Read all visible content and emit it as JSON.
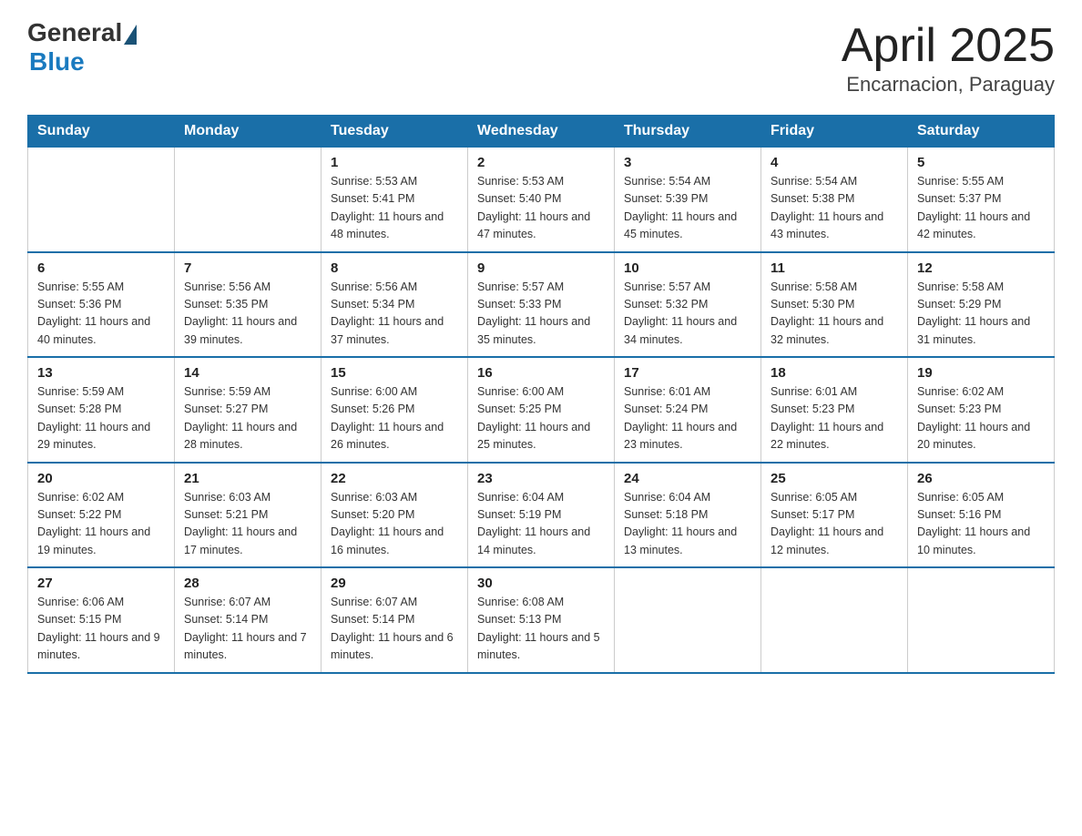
{
  "header": {
    "logo_general": "General",
    "logo_blue": "Blue",
    "month_title": "April 2025",
    "location": "Encarnacion, Paraguay"
  },
  "weekdays": [
    "Sunday",
    "Monday",
    "Tuesday",
    "Wednesday",
    "Thursday",
    "Friday",
    "Saturday"
  ],
  "weeks": [
    [
      {
        "day": "",
        "sunrise": "",
        "sunset": "",
        "daylight": ""
      },
      {
        "day": "",
        "sunrise": "",
        "sunset": "",
        "daylight": ""
      },
      {
        "day": "1",
        "sunrise": "Sunrise: 5:53 AM",
        "sunset": "Sunset: 5:41 PM",
        "daylight": "Daylight: 11 hours and 48 minutes."
      },
      {
        "day": "2",
        "sunrise": "Sunrise: 5:53 AM",
        "sunset": "Sunset: 5:40 PM",
        "daylight": "Daylight: 11 hours and 47 minutes."
      },
      {
        "day": "3",
        "sunrise": "Sunrise: 5:54 AM",
        "sunset": "Sunset: 5:39 PM",
        "daylight": "Daylight: 11 hours and 45 minutes."
      },
      {
        "day": "4",
        "sunrise": "Sunrise: 5:54 AM",
        "sunset": "Sunset: 5:38 PM",
        "daylight": "Daylight: 11 hours and 43 minutes."
      },
      {
        "day": "5",
        "sunrise": "Sunrise: 5:55 AM",
        "sunset": "Sunset: 5:37 PM",
        "daylight": "Daylight: 11 hours and 42 minutes."
      }
    ],
    [
      {
        "day": "6",
        "sunrise": "Sunrise: 5:55 AM",
        "sunset": "Sunset: 5:36 PM",
        "daylight": "Daylight: 11 hours and 40 minutes."
      },
      {
        "day": "7",
        "sunrise": "Sunrise: 5:56 AM",
        "sunset": "Sunset: 5:35 PM",
        "daylight": "Daylight: 11 hours and 39 minutes."
      },
      {
        "day": "8",
        "sunrise": "Sunrise: 5:56 AM",
        "sunset": "Sunset: 5:34 PM",
        "daylight": "Daylight: 11 hours and 37 minutes."
      },
      {
        "day": "9",
        "sunrise": "Sunrise: 5:57 AM",
        "sunset": "Sunset: 5:33 PM",
        "daylight": "Daylight: 11 hours and 35 minutes."
      },
      {
        "day": "10",
        "sunrise": "Sunrise: 5:57 AM",
        "sunset": "Sunset: 5:32 PM",
        "daylight": "Daylight: 11 hours and 34 minutes."
      },
      {
        "day": "11",
        "sunrise": "Sunrise: 5:58 AM",
        "sunset": "Sunset: 5:30 PM",
        "daylight": "Daylight: 11 hours and 32 minutes."
      },
      {
        "day": "12",
        "sunrise": "Sunrise: 5:58 AM",
        "sunset": "Sunset: 5:29 PM",
        "daylight": "Daylight: 11 hours and 31 minutes."
      }
    ],
    [
      {
        "day": "13",
        "sunrise": "Sunrise: 5:59 AM",
        "sunset": "Sunset: 5:28 PM",
        "daylight": "Daylight: 11 hours and 29 minutes."
      },
      {
        "day": "14",
        "sunrise": "Sunrise: 5:59 AM",
        "sunset": "Sunset: 5:27 PM",
        "daylight": "Daylight: 11 hours and 28 minutes."
      },
      {
        "day": "15",
        "sunrise": "Sunrise: 6:00 AM",
        "sunset": "Sunset: 5:26 PM",
        "daylight": "Daylight: 11 hours and 26 minutes."
      },
      {
        "day": "16",
        "sunrise": "Sunrise: 6:00 AM",
        "sunset": "Sunset: 5:25 PM",
        "daylight": "Daylight: 11 hours and 25 minutes."
      },
      {
        "day": "17",
        "sunrise": "Sunrise: 6:01 AM",
        "sunset": "Sunset: 5:24 PM",
        "daylight": "Daylight: 11 hours and 23 minutes."
      },
      {
        "day": "18",
        "sunrise": "Sunrise: 6:01 AM",
        "sunset": "Sunset: 5:23 PM",
        "daylight": "Daylight: 11 hours and 22 minutes."
      },
      {
        "day": "19",
        "sunrise": "Sunrise: 6:02 AM",
        "sunset": "Sunset: 5:23 PM",
        "daylight": "Daylight: 11 hours and 20 minutes."
      }
    ],
    [
      {
        "day": "20",
        "sunrise": "Sunrise: 6:02 AM",
        "sunset": "Sunset: 5:22 PM",
        "daylight": "Daylight: 11 hours and 19 minutes."
      },
      {
        "day": "21",
        "sunrise": "Sunrise: 6:03 AM",
        "sunset": "Sunset: 5:21 PM",
        "daylight": "Daylight: 11 hours and 17 minutes."
      },
      {
        "day": "22",
        "sunrise": "Sunrise: 6:03 AM",
        "sunset": "Sunset: 5:20 PM",
        "daylight": "Daylight: 11 hours and 16 minutes."
      },
      {
        "day": "23",
        "sunrise": "Sunrise: 6:04 AM",
        "sunset": "Sunset: 5:19 PM",
        "daylight": "Daylight: 11 hours and 14 minutes."
      },
      {
        "day": "24",
        "sunrise": "Sunrise: 6:04 AM",
        "sunset": "Sunset: 5:18 PM",
        "daylight": "Daylight: 11 hours and 13 minutes."
      },
      {
        "day": "25",
        "sunrise": "Sunrise: 6:05 AM",
        "sunset": "Sunset: 5:17 PM",
        "daylight": "Daylight: 11 hours and 12 minutes."
      },
      {
        "day": "26",
        "sunrise": "Sunrise: 6:05 AM",
        "sunset": "Sunset: 5:16 PM",
        "daylight": "Daylight: 11 hours and 10 minutes."
      }
    ],
    [
      {
        "day": "27",
        "sunrise": "Sunrise: 6:06 AM",
        "sunset": "Sunset: 5:15 PM",
        "daylight": "Daylight: 11 hours and 9 minutes."
      },
      {
        "day": "28",
        "sunrise": "Sunrise: 6:07 AM",
        "sunset": "Sunset: 5:14 PM",
        "daylight": "Daylight: 11 hours and 7 minutes."
      },
      {
        "day": "29",
        "sunrise": "Sunrise: 6:07 AM",
        "sunset": "Sunset: 5:14 PM",
        "daylight": "Daylight: 11 hours and 6 minutes."
      },
      {
        "day": "30",
        "sunrise": "Sunrise: 6:08 AM",
        "sunset": "Sunset: 5:13 PM",
        "daylight": "Daylight: 11 hours and 5 minutes."
      },
      {
        "day": "",
        "sunrise": "",
        "sunset": "",
        "daylight": ""
      },
      {
        "day": "",
        "sunrise": "",
        "sunset": "",
        "daylight": ""
      },
      {
        "day": "",
        "sunrise": "",
        "sunset": "",
        "daylight": ""
      }
    ]
  ]
}
